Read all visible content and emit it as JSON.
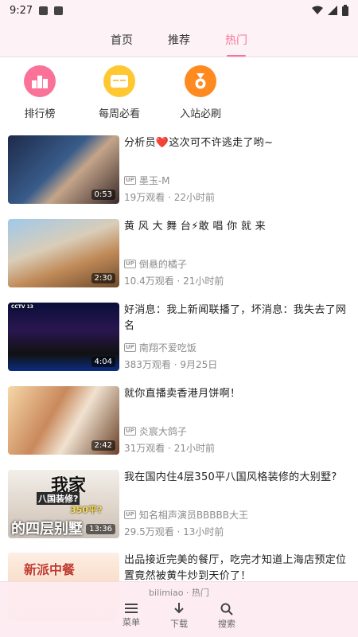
{
  "status_bar": {
    "time": "9:27"
  },
  "tabs": [
    {
      "label": "首页",
      "active": false
    },
    {
      "label": "推荐",
      "active": false
    },
    {
      "label": "热门",
      "active": true
    }
  ],
  "accent_color": "#fb7299",
  "shortcuts": [
    {
      "label": "排行榜",
      "icon": "ranking-icon",
      "color": "#fb7299"
    },
    {
      "label": "每周必看",
      "icon": "weekly-ticket-icon",
      "color": "#ffc730"
    },
    {
      "label": "入站必刷",
      "icon": "medal-icon",
      "color": "#ff8a1f"
    }
  ],
  "videos": [
    {
      "title": "分析员❤️这次可不许逃走了哟~",
      "uploader": "墨玉-M",
      "stats": "19万观看 · 22小时前",
      "duration": "0:53"
    },
    {
      "title": "黄 风 大 舞 台⚡敢 唱 你 就 来",
      "uploader": "倒悬的橘子",
      "stats": "10.4万观看 · 21小时前",
      "duration": "2:30"
    },
    {
      "title": "好消息：我上新闻联播了，坏消息：我失去了网名",
      "uploader": "南翔不爱吃饭",
      "stats": "383万观看 · 9月25日",
      "duration": "4:04",
      "thumb_text": "CCTV 13"
    },
    {
      "title": "就你直播卖香港月饼啊！",
      "uploader": "炎宸大鸽子",
      "stats": "31万观看 · 21小时前",
      "duration": "2:42"
    },
    {
      "title": "我在国内住4层350平八国风格装修的大别墅?",
      "uploader": "知名相声演员BBBBB大王",
      "stats": "29.5万观看 · 13小时前",
      "duration": "13:36",
      "thumb_text_top": "我家",
      "thumb_text_q1": "八国装修?",
      "thumb_text_q2": "350平?",
      "thumb_text_bottom": "的四层别墅"
    },
    {
      "title": "出品接近完美的餐厅，吃完才知道上海店预定位置竟然被黄牛炒到天价了！",
      "uploader": "",
      "stats": "",
      "duration": "",
      "thumb_text": "新派中餐"
    }
  ],
  "up_badge": "UP",
  "bottom_nav": {
    "caption": "bilimiao · 热门",
    "items": [
      {
        "label": "菜单",
        "icon": "menu-icon"
      },
      {
        "label": "下载",
        "icon": "download-icon"
      },
      {
        "label": "搜索",
        "icon": "search-icon"
      }
    ]
  }
}
